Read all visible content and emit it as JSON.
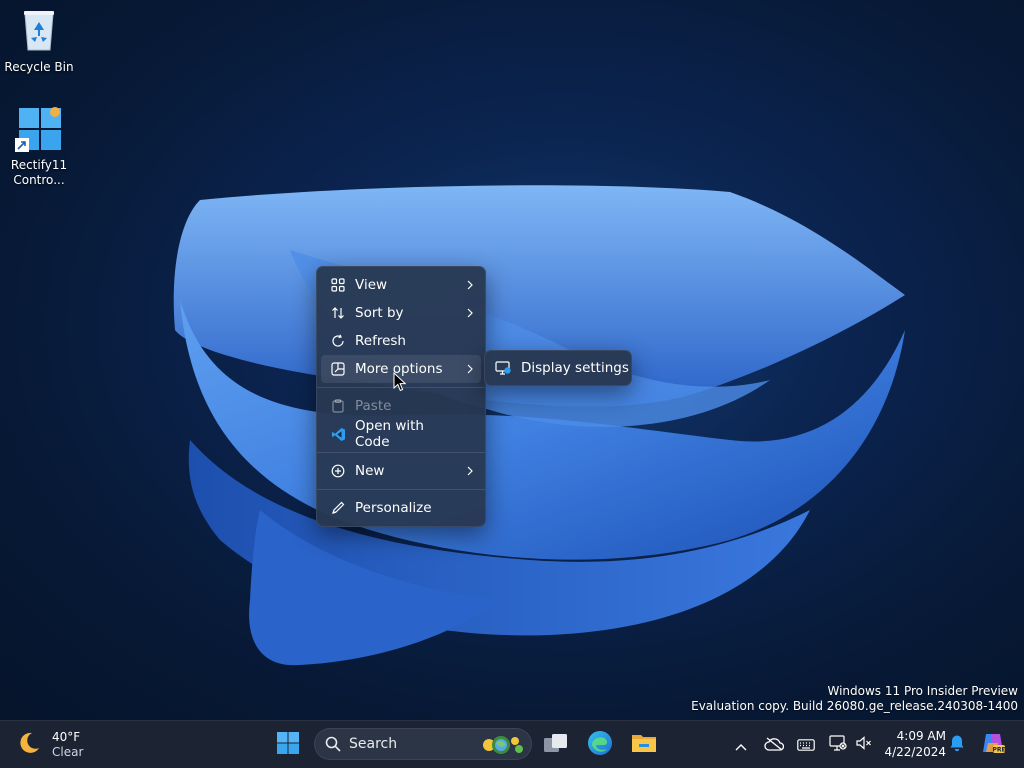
{
  "desktop": {
    "icons": [
      {
        "label": "Recycle Bin",
        "icon": "recycle-bin-icon"
      },
      {
        "label": "Rectify11 Contro...",
        "icon": "control-panel-icon"
      }
    ],
    "watermark": {
      "line1": "Windows 11 Pro Insider Preview",
      "line2": "Evaluation copy. Build 26080.ge_release.240308-1400"
    }
  },
  "context_menu": {
    "items": [
      {
        "label": "View",
        "icon": "grid-icon",
        "has_submenu": true
      },
      {
        "label": "Sort by",
        "icon": "sort-icon",
        "has_submenu": true
      },
      {
        "label": "Refresh",
        "icon": "refresh-icon",
        "has_submenu": false
      },
      {
        "label": "More options",
        "icon": "more-options-icon",
        "has_submenu": true
      },
      {
        "label": "Paste",
        "icon": "paste-icon",
        "disabled": true
      },
      {
        "label": "Open with Code",
        "icon": "vscode-icon"
      },
      {
        "label": "New",
        "icon": "new-icon",
        "has_submenu": true
      },
      {
        "label": "Personalize",
        "icon": "pen-icon"
      }
    ],
    "submenu": {
      "label": "Display settings",
      "icon": "display-settings-icon"
    }
  },
  "taskbar": {
    "weather": {
      "temp": "40°F",
      "condition": "Clear",
      "icon": "moon-icon"
    },
    "search_placeholder": "Search",
    "clock": {
      "time": "4:09 AM",
      "date": "4/22/2024"
    },
    "colors": {
      "taskbar_bg": "#1c2433",
      "accent": "#0a84ff"
    }
  }
}
